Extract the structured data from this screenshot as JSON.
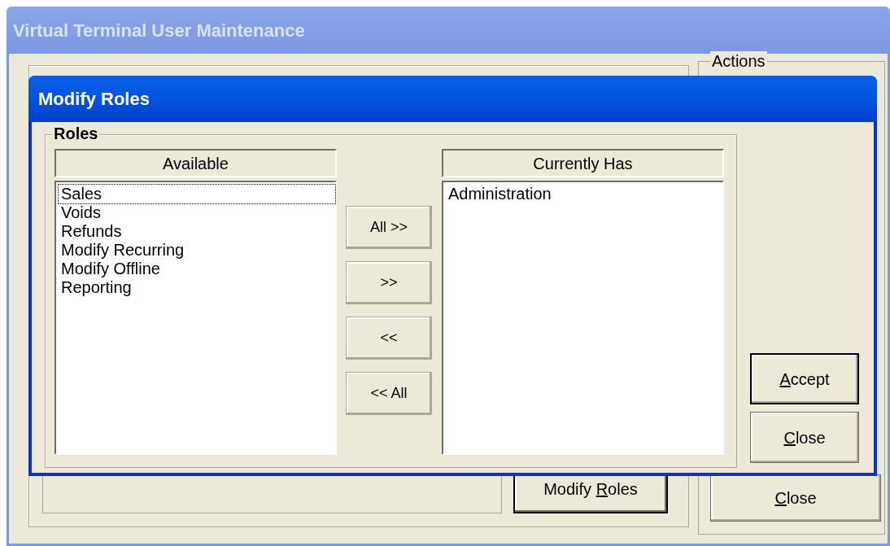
{
  "window": {
    "title": "Virtual Terminal User Maintenance"
  },
  "background": {
    "modify_roles_button": {
      "before": "Modify ",
      "key": "R",
      "after": "oles",
      "default": true
    },
    "actions": {
      "label": "Actions",
      "close_button": {
        "key": "C",
        "after": "lose",
        "default": false
      }
    }
  },
  "dialog": {
    "title": "Modify Roles",
    "group_label": "Roles",
    "available": {
      "header": "Available",
      "items": [
        {
          "label": "Sales",
          "focused": true
        },
        {
          "label": "Voids",
          "focused": false
        },
        {
          "label": "Refunds",
          "focused": false
        },
        {
          "label": "Modify Recurring",
          "focused": false
        },
        {
          "label": "Modify Offline",
          "focused": false
        },
        {
          "label": "Reporting",
          "focused": false
        }
      ]
    },
    "move_buttons": [
      "All >>",
      ">>",
      "<<",
      "<< All"
    ],
    "currently_has": {
      "header": "Currently Has",
      "items": [
        {
          "label": "Administration",
          "focused": false
        }
      ]
    },
    "buttons": [
      {
        "key": "A",
        "after": "ccept",
        "default": true
      },
      {
        "key": "C",
        "after": "lose",
        "default": false
      }
    ]
  }
}
